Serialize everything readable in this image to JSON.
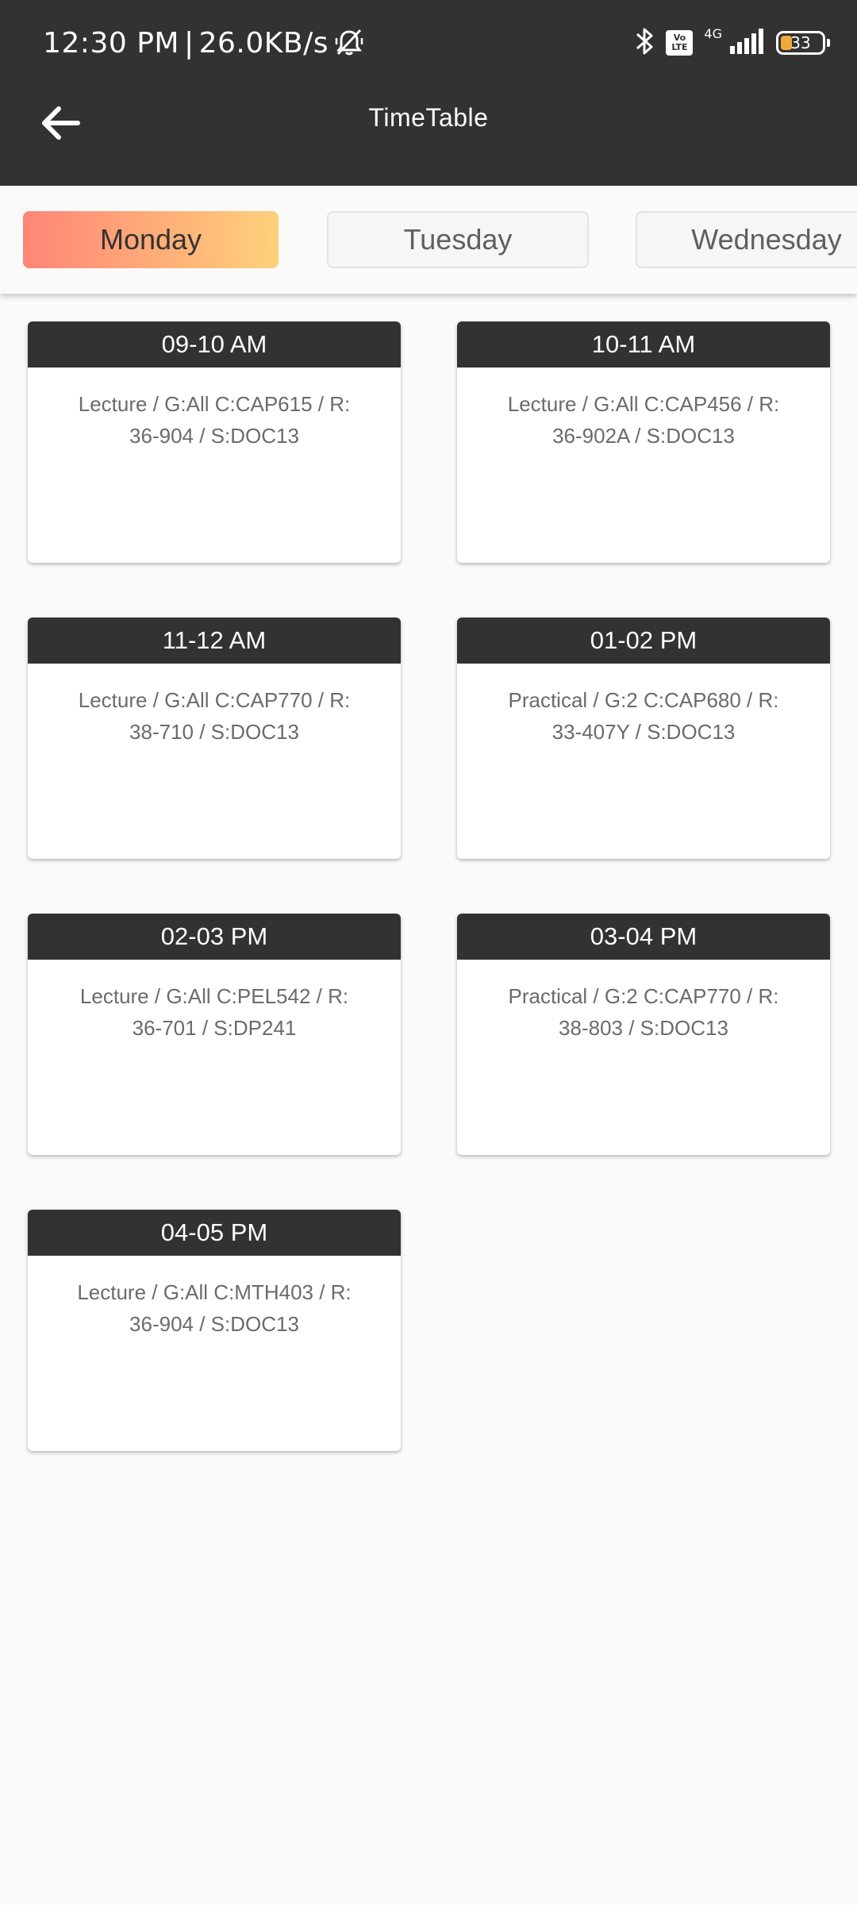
{
  "status_bar": {
    "time": "12:30 PM",
    "separator": "|",
    "speed": "26.0KB/s",
    "network_type": "4G",
    "volte_top": "Vo",
    "volte_bottom": "LTE",
    "battery": "33",
    "icons": [
      "mute-icon",
      "bluetooth-icon",
      "volte-icon",
      "signal-icon",
      "battery-icon"
    ]
  },
  "app_bar": {
    "title": "TimeTable",
    "back_icon": "arrow-left-icon"
  },
  "tabs": [
    {
      "label": "Monday",
      "active": true
    },
    {
      "label": "Tuesday",
      "active": false
    },
    {
      "label": "Wednesday",
      "active": false
    }
  ],
  "slots": [
    {
      "time": "09-10 AM",
      "line1": "Lecture / G:All C:CAP615 / R:",
      "line2": "36-904 / S:DOC13"
    },
    {
      "time": "10-11 AM",
      "line1": "Lecture / G:All C:CAP456 / R:",
      "line2": "36-902A / S:DOC13"
    },
    {
      "time": "11-12 AM",
      "line1": "Lecture / G:All C:CAP770 / R:",
      "line2": "38-710 / S:DOC13"
    },
    {
      "time": "01-02 PM",
      "line1": "Practical / G:2 C:CAP680 / R:",
      "line2": "33-407Y / S:DOC13"
    },
    {
      "time": "02-03 PM",
      "line1": "Lecture / G:All C:PEL542 / R:",
      "line2": "36-701 / S:DP241"
    },
    {
      "time": "03-04 PM",
      "line1": "Practical / G:2 C:CAP770 / R:",
      "line2": "38-803 / S:DOC13"
    },
    {
      "time": "04-05 PM",
      "line1": "Lecture / G:All C:MTH403 / R:",
      "line2": "36-904 / S:DOC13"
    }
  ],
  "colors": {
    "header_bg": "#323232",
    "page_bg": "#fafafa",
    "active_tab_gradient_start": "#ff8576",
    "active_tab_gradient_end": "#ffd17a",
    "battery_fill": "#f2a93b"
  }
}
